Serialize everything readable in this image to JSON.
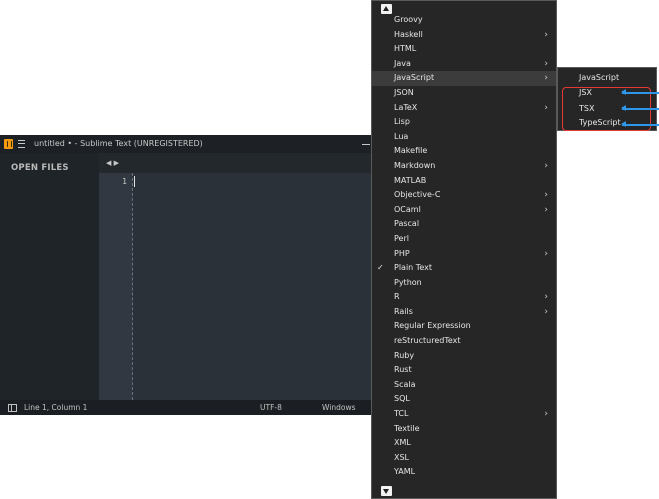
{
  "window": {
    "title": "untitled • - Sublime Text (UNREGISTERED)",
    "sidebar_title": "OPEN FILES",
    "nav_arrows": "◀ ▶",
    "line_number": "1"
  },
  "statusbar": {
    "position": "Line 1, Column 1",
    "encoding": "UTF-8",
    "line_ending": "Windows"
  },
  "menu": {
    "items": [
      {
        "label": "Groovy"
      },
      {
        "label": "Haskell",
        "submenu": true
      },
      {
        "label": "HTML"
      },
      {
        "label": "Java",
        "submenu": true
      },
      {
        "label": "JavaScript",
        "submenu": true,
        "active": true
      },
      {
        "label": "JSON"
      },
      {
        "label": "LaTeX",
        "submenu": true
      },
      {
        "label": "Lisp"
      },
      {
        "label": "Lua"
      },
      {
        "label": "Makefile"
      },
      {
        "label": "Markdown",
        "submenu": true
      },
      {
        "label": "MATLAB"
      },
      {
        "label": "Objective-C",
        "submenu": true
      },
      {
        "label": "OCaml",
        "submenu": true
      },
      {
        "label": "Pascal"
      },
      {
        "label": "Perl"
      },
      {
        "label": "PHP",
        "submenu": true
      },
      {
        "label": "Plain Text",
        "checked": true
      },
      {
        "label": "Python"
      },
      {
        "label": "R",
        "submenu": true
      },
      {
        "label": "Rails",
        "submenu": true
      },
      {
        "label": "Regular Expression"
      },
      {
        "label": "reStructuredText"
      },
      {
        "label": "Ruby"
      },
      {
        "label": "Rust"
      },
      {
        "label": "Scala"
      },
      {
        "label": "SQL"
      },
      {
        "label": "TCL",
        "submenu": true
      },
      {
        "label": "Textile"
      },
      {
        "label": "XML"
      },
      {
        "label": "XSL"
      },
      {
        "label": "YAML"
      }
    ]
  },
  "submenu": {
    "items": [
      "JavaScript",
      "JSX",
      "TSX",
      "TypeScript"
    ]
  },
  "colors": {
    "annotation_box": "#e53935",
    "annotation_arrow": "#2f95e6"
  }
}
